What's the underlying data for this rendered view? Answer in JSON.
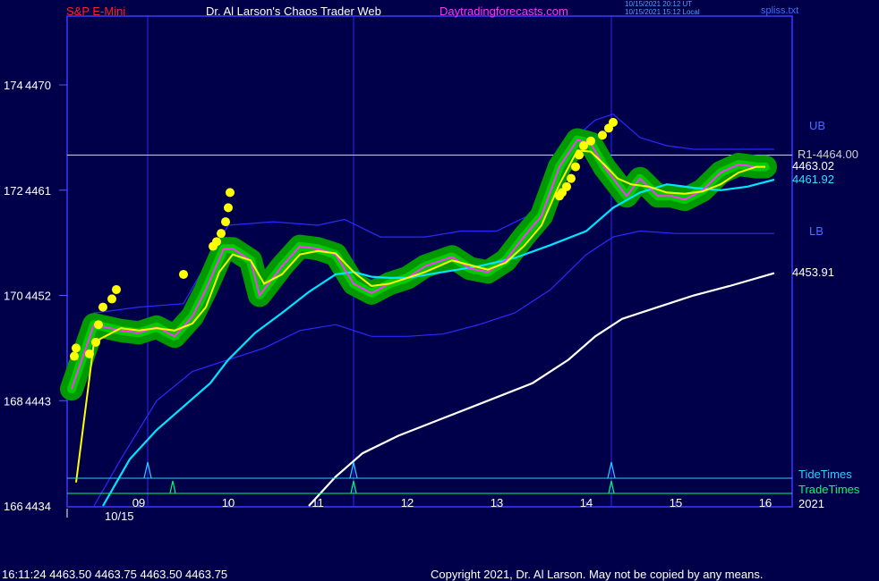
{
  "header": {
    "symbol": "S&P E-Mini",
    "site_title": "Dr. Al Larson's Chaos Trader Web",
    "site_url": "Daytradingforecasts.com",
    "stamp_ut": "10/15/2021 20:12 UT",
    "stamp_local": "10/15/2021 15:12 Local",
    "file": "spliss.txt"
  },
  "footer": {
    "quote": "16:11:24  4463.50 4463.75 4463.50 4463.75",
    "copyright": "Copyright 2021, Dr. Al Larson. May not be copied by any means."
  },
  "labels": {
    "ub": "UB",
    "lb": "LB",
    "r1": "R1-4464.00",
    "last_price": "4463.02",
    "ema_value": "4461.92",
    "slow_value": "4453.91",
    "tide_times": "TideTimes",
    "trade_times": "TradeTimes",
    "year": "2021",
    "date": "10/15"
  },
  "colors": {
    "background": "#00004a",
    "frame": "#3a3aff",
    "price": "#00cc00",
    "glow": "#009900",
    "fast_ema": "#ffff00",
    "mid_ema": "#ff33ff",
    "slow_ema": "#00e5ff",
    "very_slow": "#ffffff",
    "band": "#2a2aff",
    "dots": "#ffff00",
    "r1": "#cfcfcf",
    "tide": "#33ccff",
    "trade": "#00ff66",
    "symbol": "#ff2222",
    "site_url": "#ff33ff"
  },
  "chart_data": {
    "type": "line",
    "title": "S&P E-Mini",
    "x_ticks": [
      "09",
      "10",
      "11",
      "12",
      "13",
      "14",
      "15",
      "16"
    ],
    "x_range": [
      8.2,
      16.1
    ],
    "y_ticks": [
      {
        "left": "166",
        "right": "4434",
        "value": 4434
      },
      {
        "left": "168",
        "right": "4443",
        "value": 4443
      },
      {
        "left": "170",
        "right": "4452",
        "value": 4452
      },
      {
        "left": "172",
        "right": "4461",
        "value": 4461
      },
      {
        "left": "174",
        "right": "4470",
        "value": 4470
      }
    ],
    "ylim": [
      4434,
      4470
    ],
    "price": {
      "x": [
        8.25,
        8.5,
        8.8,
        9.0,
        9.2,
        9.4,
        9.6,
        9.75,
        9.95,
        10.05,
        10.25,
        10.35,
        10.6,
        10.8,
        11.0,
        11.2,
        11.4,
        11.6,
        11.8,
        12.0,
        12.2,
        12.5,
        12.7,
        12.9,
        13.1,
        13.3,
        13.5,
        13.7,
        13.9,
        14.05,
        14.2,
        14.35,
        14.45,
        14.6,
        14.8,
        14.95,
        15.1,
        15.3,
        15.5,
        15.7,
        15.9,
        16.0
      ],
      "y": [
        4444.0,
        4449.5,
        4449.0,
        4448.8,
        4449.3,
        4448.5,
        4450.2,
        4452.5,
        4456.0,
        4456.0,
        4455.0,
        4452.0,
        4454.5,
        4456.2,
        4456.0,
        4455.5,
        4453.0,
        4452.2,
        4453.0,
        4453.5,
        4454.5,
        4455.3,
        4454.3,
        4454.0,
        4455.0,
        4457.0,
        4458.8,
        4463.0,
        4465.3,
        4465.0,
        4463.0,
        4461.5,
        4460.5,
        4462.0,
        4460.5,
        4460.5,
        4460.2,
        4461.0,
        4462.5,
        4463.2,
        4463.0,
        4463.0
      ]
    },
    "fast_ema": {
      "x": [
        8.3,
        8.5,
        8.8,
        9.0,
        9.2,
        9.4,
        9.6,
        9.75,
        9.9,
        10.05,
        10.25,
        10.4,
        10.6,
        10.8,
        11.0,
        11.2,
        11.4,
        11.6,
        11.8,
        12.0,
        12.2,
        12.5,
        12.7,
        12.9,
        13.1,
        13.3,
        13.5,
        13.7,
        13.9,
        14.05,
        14.2,
        14.35,
        14.5,
        14.7,
        14.9,
        15.1,
        15.3,
        15.5,
        15.7,
        15.9,
        16.0
      ],
      "y": [
        4436.0,
        4448.0,
        4449.2,
        4449.0,
        4449.2,
        4449.0,
        4449.6,
        4451.0,
        4454.0,
        4455.5,
        4455.0,
        4453.0,
        4453.8,
        4455.5,
        4455.8,
        4455.6,
        4454.0,
        4452.8,
        4453.0,
        4453.5,
        4454.0,
        4455.0,
        4454.6,
        4454.2,
        4454.8,
        4456.2,
        4458.0,
        4461.5,
        4464.4,
        4464.3,
        4463.2,
        4462.0,
        4461.5,
        4461.3,
        4460.8,
        4460.7,
        4460.9,
        4461.5,
        4462.5,
        4463.0,
        4463.0
      ]
    },
    "slow_ema": {
      "x": [
        8.6,
        8.9,
        9.2,
        9.5,
        9.8,
        10.0,
        10.3,
        10.6,
        10.9,
        11.2,
        11.4,
        11.6,
        11.8,
        12.0,
        12.4,
        12.8,
        13.2,
        13.6,
        14.0,
        14.3,
        14.6,
        14.9,
        15.2,
        15.5,
        15.8,
        16.1
      ],
      "y": [
        4434.0,
        4438.0,
        4440.5,
        4442.5,
        4444.5,
        4446.5,
        4448.8,
        4450.5,
        4452.3,
        4453.8,
        4454.0,
        4453.6,
        4453.5,
        4453.5,
        4454.0,
        4454.5,
        4455.2,
        4456.3,
        4457.5,
        4459.5,
        4460.8,
        4461.5,
        4461.2,
        4461.0,
        4461.3,
        4461.9
      ]
    },
    "very_slow": {
      "x": [
        10.9,
        11.2,
        11.5,
        11.9,
        12.4,
        12.9,
        13.4,
        13.8,
        14.1,
        14.4,
        14.8,
        15.2,
        15.6,
        16.1
      ],
      "y": [
        4434.0,
        4436.5,
        4438.5,
        4440.0,
        4441.5,
        4443.0,
        4444.5,
        4446.5,
        4448.5,
        4450.0,
        4451.0,
        4452.0,
        4452.8,
        4453.9
      ]
    },
    "upper_band": {
      "x": [
        8.2,
        8.5,
        9.0,
        9.5,
        10.0,
        10.5,
        11.0,
        11.3,
        11.7,
        12.2,
        12.6,
        13.0,
        13.4,
        13.8,
        14.1,
        14.3,
        14.6,
        14.9,
        15.2,
        15.6,
        16.1
      ],
      "y": [
        4446.0,
        4450.5,
        4451.0,
        4451.3,
        4458.0,
        4458.3,
        4458.0,
        4458.5,
        4457.0,
        4457.0,
        4457.5,
        4457.5,
        4459.0,
        4465.0,
        4467.0,
        4467.5,
        4465.5,
        4464.8,
        4464.5,
        4464.5,
        4464.5
      ]
    },
    "lower_band": {
      "x": [
        8.5,
        8.8,
        9.2,
        9.6,
        10.0,
        10.4,
        10.8,
        11.2,
        11.6,
        12.0,
        12.4,
        12.8,
        13.2,
        13.6,
        14.0,
        14.3,
        14.6,
        15.0,
        15.4,
        15.8,
        16.1
      ],
      "y": [
        4434.0,
        4438.0,
        4443.0,
        4445.5,
        4446.5,
        4447.5,
        4449.0,
        4449.5,
        4448.5,
        4448.5,
        4448.7,
        4449.5,
        4450.5,
        4452.5,
        4455.5,
        4457.0,
        4457.5,
        4457.3,
        4457.3,
        4457.3,
        4457.3
      ]
    },
    "r1_level": 4464.0,
    "yellow_dots": [
      {
        "x": 8.3,
        "y": 4447.5
      },
      {
        "x": 8.28,
        "y": 4446.8
      },
      {
        "x": 8.45,
        "y": 4447.0
      },
      {
        "x": 8.52,
        "y": 4448.0
      },
      {
        "x": 8.55,
        "y": 4449.5
      },
      {
        "x": 8.6,
        "y": 4451.0
      },
      {
        "x": 8.7,
        "y": 4451.7
      },
      {
        "x": 8.75,
        "y": 4452.5
      },
      {
        "x": 9.5,
        "y": 4453.8
      },
      {
        "x": 9.83,
        "y": 4456.2
      },
      {
        "x": 9.87,
        "y": 4456.6
      },
      {
        "x": 9.92,
        "y": 4457.3
      },
      {
        "x": 9.97,
        "y": 4458.3
      },
      {
        "x": 10.0,
        "y": 4459.5
      },
      {
        "x": 10.02,
        "y": 4460.8
      },
      {
        "x": 13.7,
        "y": 4460.5
      },
      {
        "x": 13.73,
        "y": 4460.8
      },
      {
        "x": 13.78,
        "y": 4461.3
      },
      {
        "x": 13.83,
        "y": 4462.0
      },
      {
        "x": 13.88,
        "y": 4463.0
      },
      {
        "x": 13.92,
        "y": 4464.0
      },
      {
        "x": 13.97,
        "y": 4464.8
      },
      {
        "x": 14.05,
        "y": 4465.2
      },
      {
        "x": 14.18,
        "y": 4465.7
      },
      {
        "x": 14.25,
        "y": 4466.3
      },
      {
        "x": 14.3,
        "y": 4466.8
      }
    ],
    "tide_times": [
      9.1,
      11.4,
      14.28
    ],
    "trade_times": [
      9.38,
      11.4,
      14.28
    ],
    "tick_date": "10/15",
    "date_x": 8.6
  }
}
